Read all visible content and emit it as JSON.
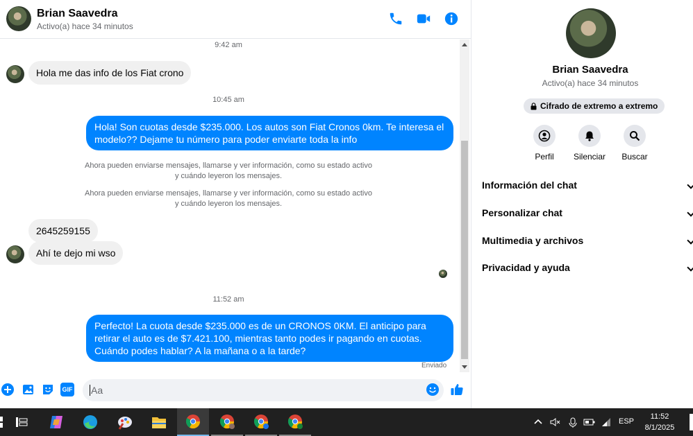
{
  "header": {
    "contact_name": "Brian Saavedra",
    "status": "Activo(a) hace 34 minutos",
    "icons": [
      "phone-icon",
      "video-camera-icon",
      "info-icon"
    ]
  },
  "messages": {
    "timestamps": [
      "9:42 am",
      "10:45 am",
      "11:52 am"
    ],
    "incoming": [
      "Hola me das info de los Fiat crono",
      "2645259155",
      "Ahí te dejo mi wso"
    ],
    "outgoing": [
      "Hola! Son cuotas desde $235.000. Los autos son Fiat Cronos 0km. Te interesa el modelo?? Dejame tu número para poder enviarte toda la info",
      "Perfecto! La cuota desde $235.000 es de un CRONOS 0KM. El anticipo para retirar el auto es de $7.421.100, mientras tanto podes ir pagando en cuotas. Cuándo podes hablar? A la mañana o a la tarde?"
    ],
    "system": [
      {
        "line1": "Ahora pueden enviarse mensajes, llamarse y ver información, como su estado activo",
        "line2": "y cuándo leyeron los mensajes."
      },
      {
        "line1": "Ahora pueden enviarse mensajes, llamarse y ver información, como su estado activo",
        "line2": "y cuándo leyeron los mensajes."
      }
    ],
    "sent_label": "Enviado"
  },
  "composer": {
    "placeholder": "Aa",
    "icons": [
      "plus-icon",
      "gallery-icon",
      "sticker-icon",
      "gif-icon",
      "emoji-icon",
      "like-icon"
    ],
    "gif_label": "GIF"
  },
  "info_panel": {
    "name": "Brian Saavedra",
    "status": "Activo(a) hace 34 minutos",
    "encryption": "Cifrado de extremo a extremo",
    "actions": [
      {
        "label": "Perfil",
        "icon": "profile-icon"
      },
      {
        "label": "Silenciar",
        "icon": "bell-icon"
      },
      {
        "label": "Buscar",
        "icon": "search-icon"
      }
    ],
    "sections": [
      "Información del chat",
      "Personalizar chat",
      "Multimedia y archivos",
      "Privacidad y ayuda"
    ]
  },
  "taskbar": {
    "apps": [
      "task-view-icon",
      "copilot-icon",
      "edge-icon",
      "paint-icon",
      "file-explorer-icon",
      "chrome-icon",
      "chrome-profile-icon",
      "chrome-profile-v-icon",
      "chrome-profile-t-icon"
    ],
    "language": "ESP",
    "time": "11:52",
    "date": "8/1/2025"
  },
  "colors": {
    "accent": "#0084ff",
    "incoming_bubble": "#f0f0f0",
    "taskbar": "#202020"
  }
}
